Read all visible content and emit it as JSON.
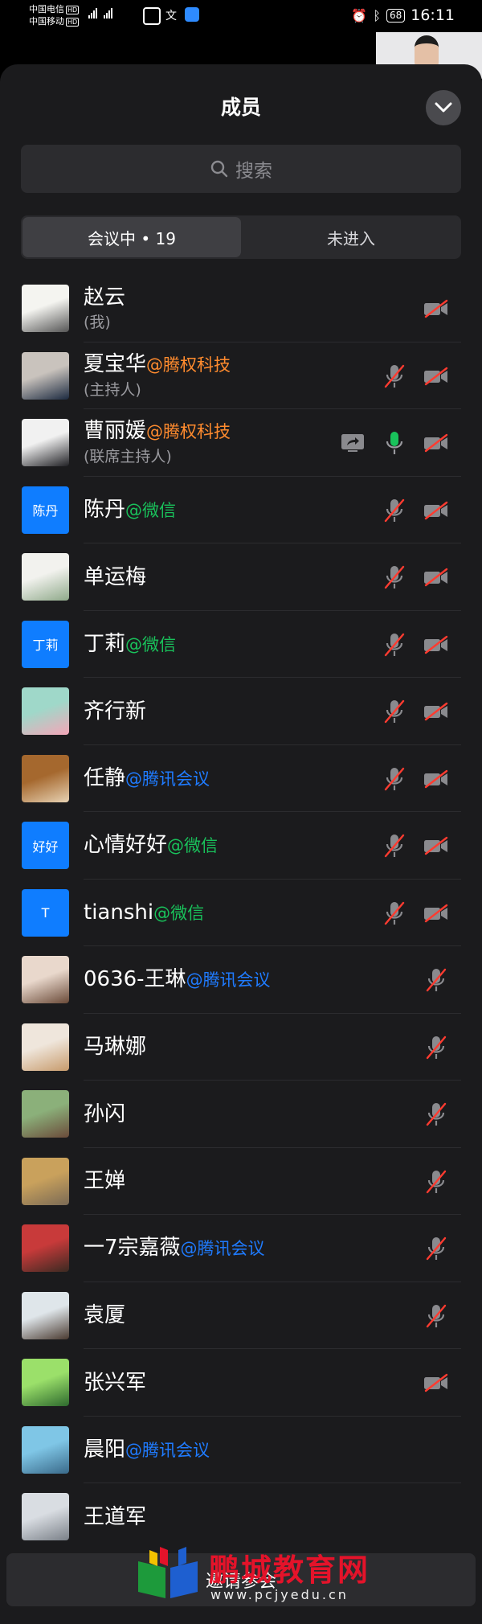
{
  "status_bar": {
    "carrier1": "中国电信",
    "carrier2": "中国移动",
    "hd": "HD",
    "battery": "68",
    "time": "16:11"
  },
  "panel": {
    "title": "成员",
    "search_placeholder": "搜索",
    "tabs": [
      {
        "label": "会议中 • 19",
        "active": true
      },
      {
        "label": "未进入",
        "active": false
      }
    ]
  },
  "members": [
    {
      "name": "赵云",
      "org": "",
      "org_color": "",
      "role": "(我)",
      "avatar_text": "",
      "avatar_colors": [
        "#f4f4f0",
        "#555555"
      ],
      "share": false,
      "mic": "none",
      "video": "off"
    },
    {
      "name": "夏宝华",
      "org": "@腾权科技",
      "org_color": "orange",
      "role": "(主持人)",
      "avatar_text": "",
      "avatar_colors": [
        "#c9c3bd",
        "#1c2a40"
      ],
      "share": false,
      "mic": "muted",
      "video": "off"
    },
    {
      "name": "曹丽媛",
      "org": "@腾权科技",
      "org_color": "orange",
      "role": "(联席主持人)",
      "avatar_text": "",
      "avatar_colors": [
        "#f1f1f1",
        "#202024"
      ],
      "share": true,
      "mic": "active",
      "video": "off"
    },
    {
      "name": "陈丹",
      "org": "@微信",
      "org_color": "green",
      "role": "",
      "avatar_text": "陈丹",
      "avatar_colors": [
        "#0f7dff",
        "#0f7dff"
      ],
      "share": false,
      "mic": "muted",
      "video": "off"
    },
    {
      "name": "单运梅",
      "org": "",
      "org_color": "",
      "role": "",
      "avatar_text": "",
      "avatar_colors": [
        "#f2f2ee",
        "#8fa98a"
      ],
      "share": false,
      "mic": "muted",
      "video": "off"
    },
    {
      "name": "丁莉",
      "org": "@微信",
      "org_color": "green",
      "role": "",
      "avatar_text": "丁莉",
      "avatar_colors": [
        "#0f7dff",
        "#0f7dff"
      ],
      "share": false,
      "mic": "muted",
      "video": "off"
    },
    {
      "name": "齐行新",
      "org": "",
      "org_color": "",
      "role": "",
      "avatar_text": "",
      "avatar_colors": [
        "#9fd8c9",
        "#f4a6b8"
      ],
      "share": false,
      "mic": "muted",
      "video": "off"
    },
    {
      "name": "任静",
      "org": "@腾讯会议",
      "org_color": "blue",
      "role": "",
      "avatar_text": "",
      "avatar_colors": [
        "#a5682e",
        "#e7d2b3"
      ],
      "share": false,
      "mic": "muted",
      "video": "off"
    },
    {
      "name": "心情好好",
      "org": "@微信",
      "org_color": "green",
      "role": "",
      "avatar_text": "好好",
      "avatar_colors": [
        "#0f7dff",
        "#0f7dff"
      ],
      "share": false,
      "mic": "muted",
      "video": "off"
    },
    {
      "name": "tianshi",
      "org": "@微信",
      "org_color": "green",
      "role": "",
      "avatar_text": "T",
      "avatar_colors": [
        "#0f7dff",
        "#0f7dff"
      ],
      "share": false,
      "mic": "muted",
      "video": "off"
    },
    {
      "name": "0636-王琳",
      "org": "@腾讯会议",
      "org_color": "blue",
      "role": "",
      "avatar_text": "",
      "avatar_colors": [
        "#e9d8cc",
        "#6a4a38"
      ],
      "share": false,
      "mic": "muted",
      "video": "none"
    },
    {
      "name": "马琳娜",
      "org": "",
      "org_color": "",
      "role": "",
      "avatar_text": "",
      "avatar_colors": [
        "#efe6dc",
        "#c79b6c"
      ],
      "share": false,
      "mic": "muted",
      "video": "none"
    },
    {
      "name": "孙闪",
      "org": "",
      "org_color": "",
      "role": "",
      "avatar_text": "",
      "avatar_colors": [
        "#8bb07a",
        "#6b4b3a"
      ],
      "share": false,
      "mic": "muted",
      "video": "none"
    },
    {
      "name": "王婵",
      "org": "",
      "org_color": "",
      "role": "",
      "avatar_text": "",
      "avatar_colors": [
        "#c9a15c",
        "#7a6a55"
      ],
      "share": false,
      "mic": "muted",
      "video": "none"
    },
    {
      "name": "一7宗嘉薇",
      "org": "@腾讯会议",
      "org_color": "blue",
      "role": "",
      "avatar_text": "",
      "avatar_colors": [
        "#c83a3a",
        "#3a2a22"
      ],
      "share": false,
      "mic": "muted",
      "video": "none"
    },
    {
      "name": "袁厦",
      "org": "",
      "org_color": "",
      "role": "",
      "avatar_text": "",
      "avatar_colors": [
        "#dfe6ea",
        "#4a3a30"
      ],
      "share": false,
      "mic": "muted",
      "video": "none"
    },
    {
      "name": "张兴军",
      "org": "",
      "org_color": "",
      "role": "",
      "avatar_text": "",
      "avatar_colors": [
        "#9be06a",
        "#2e6a2e"
      ],
      "share": false,
      "mic": "none",
      "video": "off"
    },
    {
      "name": "晨阳",
      "org": "@腾讯会议",
      "org_color": "blue",
      "role": "",
      "avatar_text": "",
      "avatar_colors": [
        "#7fc6e6",
        "#3a6a8a"
      ],
      "share": false,
      "mic": "none",
      "video": "none"
    },
    {
      "name": "王道军",
      "org": "",
      "org_color": "",
      "role": "",
      "avatar_text": "",
      "avatar_colors": [
        "#d9dde2",
        "#7a8088"
      ],
      "share": false,
      "mic": "none",
      "video": "none"
    }
  ],
  "footer": {
    "invite_label": "邀请参会",
    "watermark_title": "鹏城教育网",
    "watermark_url": "www.pcjyedu.cn"
  },
  "colors": {
    "accent_blue": "#0f7dff",
    "org_orange": "#ff8b2e",
    "org_green": "#19c25b",
    "org_blue": "#1f7bff",
    "muted_red": "#ff3b30",
    "active_green": "#19c25b"
  }
}
